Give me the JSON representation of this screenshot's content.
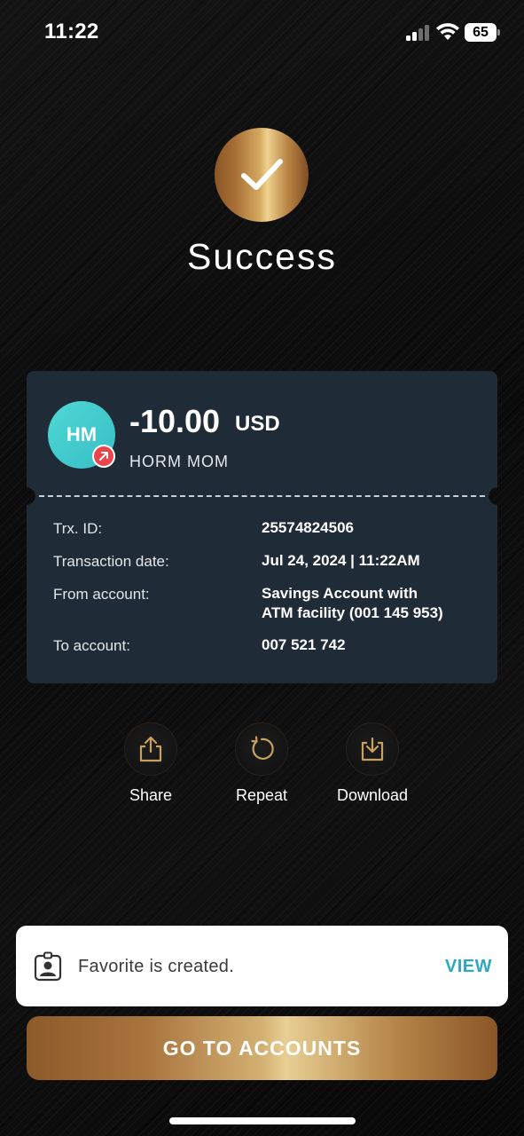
{
  "status_bar": {
    "time": "11:22",
    "battery": "65"
  },
  "header": {
    "title": "Success",
    "icon": "checkmark-icon"
  },
  "transaction": {
    "avatar_initials": "HM",
    "amount": "-10.00",
    "currency": "USD",
    "recipient": "HORM MOM",
    "rows": [
      {
        "label": "Trx. ID:",
        "value": "25574824506"
      },
      {
        "label": "Transaction date:",
        "value": "Jul 24, 2024 | 11:22AM"
      },
      {
        "label": "From account:",
        "value_line1": "Savings Account with",
        "value_line2": "ATM facility (001 145 953)"
      },
      {
        "label": "To account:",
        "value": "007 521 742"
      }
    ]
  },
  "actions": [
    {
      "label": "Share",
      "icon": "share-icon"
    },
    {
      "label": "Repeat",
      "icon": "repeat-icon"
    },
    {
      "label": "Download",
      "icon": "download-icon"
    }
  ],
  "toast": {
    "message": "Favorite is created.",
    "action": "VIEW",
    "icon": "contact-card-icon"
  },
  "primary_button": {
    "label": "GO TO ACCOUNTS"
  },
  "colors": {
    "gold": "#c8a060",
    "card_bg": "#1f2b36",
    "avatar": "#43cfcf",
    "badge": "#e8454d",
    "toast_action": "#2aa9c4"
  }
}
